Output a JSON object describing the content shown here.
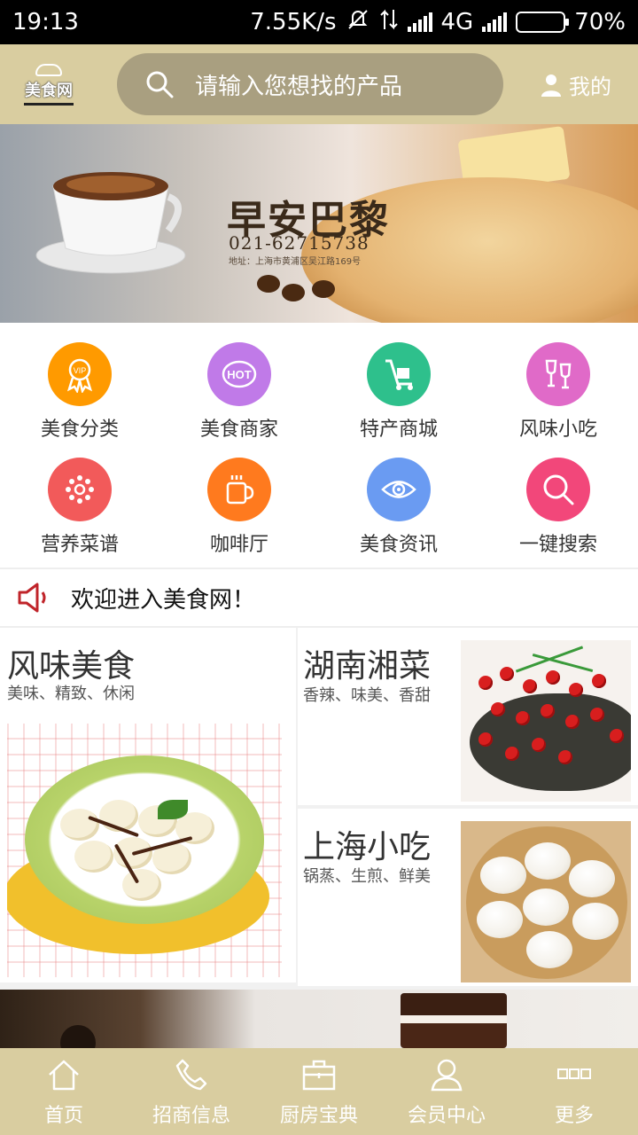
{
  "status_bar": {
    "time": "19:13",
    "speed": "7.55K/s",
    "network": "4G",
    "battery": "70%",
    "battery_level": 0.7
  },
  "header": {
    "logo_text": "美食网",
    "search_placeholder": "请输入您想找的产品",
    "mine_label": "我的"
  },
  "banner": {
    "title": "早安巴黎",
    "phone": "021-62715738",
    "address": "地址：上海市黄浦区吴江路169号"
  },
  "categories": [
    {
      "label": "美食分类",
      "icon": "vip-badge-icon",
      "color": "#ff9a00"
    },
    {
      "label": "美食商家",
      "icon": "hot-icon",
      "color": "#c07ae8"
    },
    {
      "label": "特产商城",
      "icon": "hand-truck-icon",
      "color": "#2ec08c"
    },
    {
      "label": "风味小吃",
      "icon": "wine-glasses-icon",
      "color": "#e06ac8"
    },
    {
      "label": "营养菜谱",
      "icon": "flower-icon",
      "color": "#f25a5a"
    },
    {
      "label": "咖啡厅",
      "icon": "coffee-cup-icon",
      "color": "#ff7a1e"
    },
    {
      "label": "美食资讯",
      "icon": "eye-icon",
      "color": "#6a9bf2"
    },
    {
      "label": "一键搜索",
      "icon": "search-icon",
      "color": "#f2477a"
    }
  ],
  "notice": {
    "text": "欢迎进入美食网！"
  },
  "food": {
    "left": {
      "title": "风味美食",
      "subtitle": "美味、精致、休闲"
    },
    "right_top": {
      "title": "湖南湘菜",
      "subtitle": "香辣、味美、香甜"
    },
    "right_bottom": {
      "title": "上海小吃",
      "subtitle": "锅蒸、生煎、鲜美"
    }
  },
  "bottom_nav": [
    {
      "label": "首页",
      "icon": "home-icon"
    },
    {
      "label": "招商信息",
      "icon": "phone-icon"
    },
    {
      "label": "厨房宝典",
      "icon": "briefcase-icon"
    },
    {
      "label": "会员中心",
      "icon": "user-icon"
    },
    {
      "label": "更多",
      "icon": "more-icon"
    }
  ],
  "colors": {
    "header_bg": "#d9cda0",
    "search_bg": "#a99f80",
    "nav_bg": "#d9cda0"
  }
}
